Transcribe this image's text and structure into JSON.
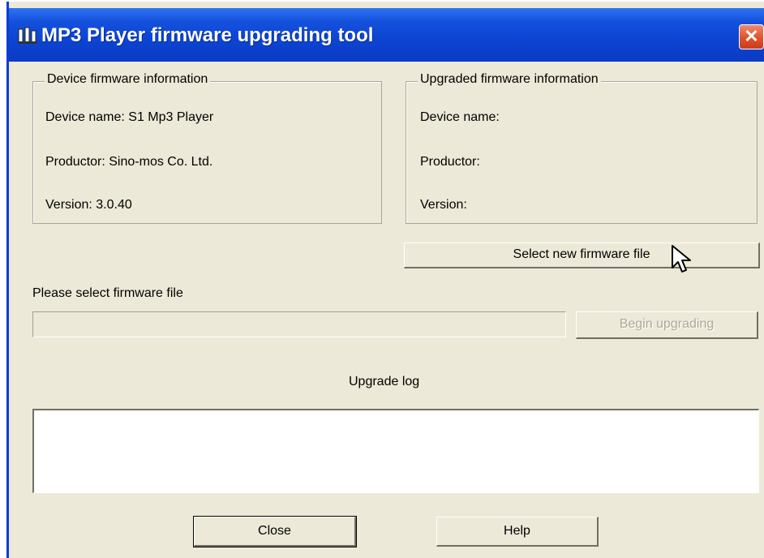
{
  "window": {
    "title": "MP3 Player firmware upgrading tool",
    "close_glyph": "✕",
    "title_bar_color": "#0c44d2",
    "close_button_color": "#e0512c"
  },
  "device_info": {
    "legend": "Device firmware information",
    "device_name": "Device name: S1 Mp3 Player",
    "productor": "Productor: Sino-mos Co. Ltd.",
    "version": "Version: 3.0.40"
  },
  "upgraded_info": {
    "legend": "Upgraded firmware information",
    "device_name": "Device name:",
    "productor": "Productor:",
    "version": "Version:"
  },
  "select_button": {
    "label": "Select new firmware file"
  },
  "file": {
    "prompt": "Please select firmware file",
    "path_value": ""
  },
  "begin_button": {
    "label": "Begin upgrading",
    "enabled": false
  },
  "log": {
    "label": "Upgrade log",
    "content": ""
  },
  "footer": {
    "close_label": "Close",
    "help_label": "Help"
  },
  "icons": {
    "app": "mp3-app-icon",
    "close": "close-icon",
    "cursor": "mouse-pointer-icon"
  }
}
